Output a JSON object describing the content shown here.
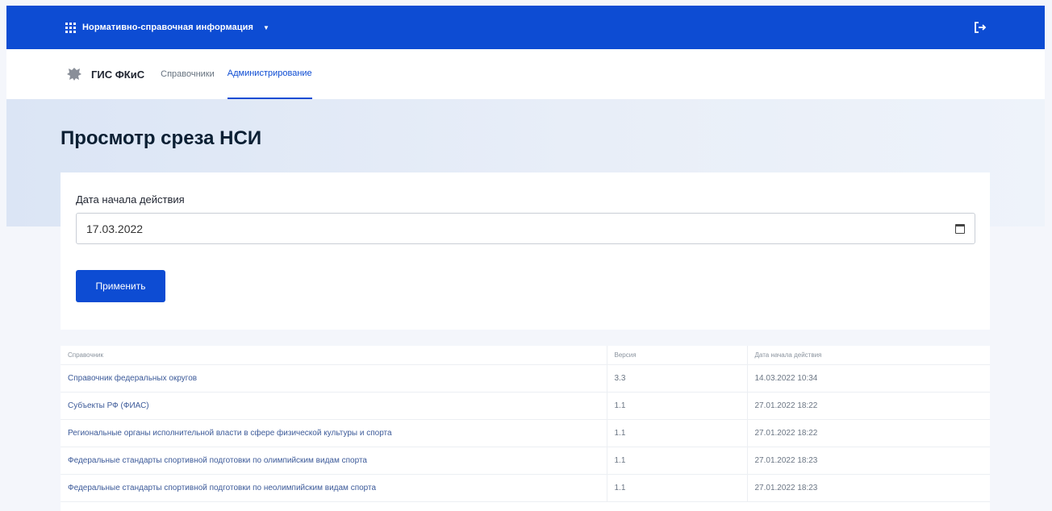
{
  "topbar": {
    "app_title": "Нормативно-справочная информация",
    "app_icon": "grid-icon",
    "logout_icon": "logout-icon",
    "accent": "#0d4cd3"
  },
  "nav": {
    "brand": "ГИС ФКиС",
    "links": [
      {
        "label": "Справочники",
        "active": false
      },
      {
        "label": "Администрирование",
        "active": true
      }
    ]
  },
  "page": {
    "title": "Просмотр среза НСИ"
  },
  "filter": {
    "date_label": "Дата начала действия",
    "date_value": "17.03.2022",
    "apply_label": "Применить"
  },
  "table": {
    "columns": [
      "Справочник",
      "Версия",
      "Дата начала действия"
    ],
    "rows": [
      {
        "name": "Справочник федеральных округов",
        "version": "3.3",
        "date": "14.03.2022 10:34"
      },
      {
        "name": "Субъекты РФ (ФИАС)",
        "version": "1.1",
        "date": "27.01.2022 18:22"
      },
      {
        "name": "Региональные органы исполнительной власти в сфере физической культуры и спорта",
        "version": "1.1",
        "date": "27.01.2022 18:22"
      },
      {
        "name": "Федеральные стандарты спортивной подготовки по олимпийским видам спорта",
        "version": "1.1",
        "date": "27.01.2022 18:23"
      },
      {
        "name": "Федеральные стандарты спортивной подготовки по неолимпийским видам спорта",
        "version": "1.1",
        "date": "27.01.2022 18:23"
      }
    ]
  }
}
